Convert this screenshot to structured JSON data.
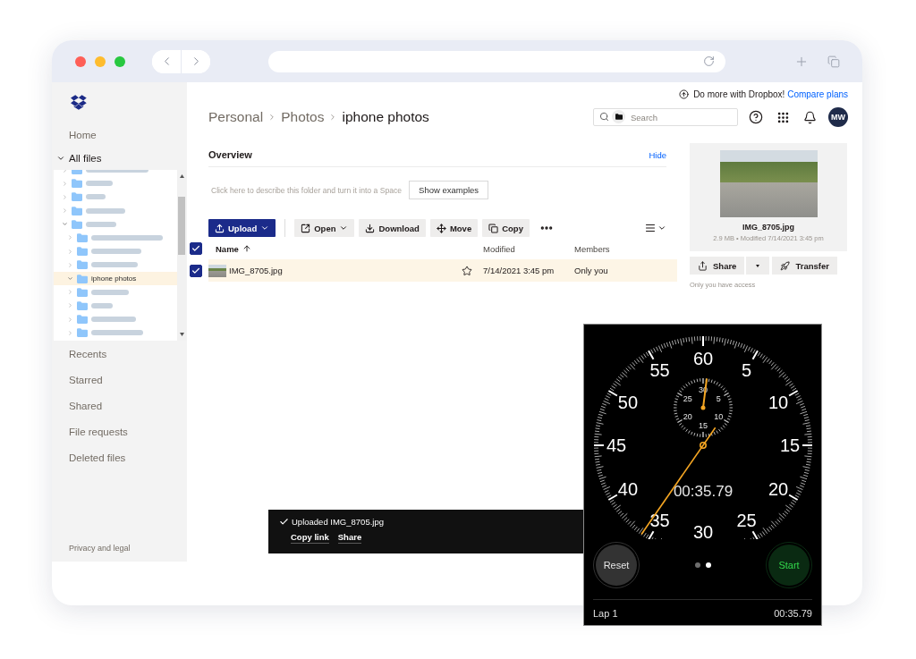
{
  "banner": {
    "text": "Do more with Dropbox!",
    "link": "Compare plans"
  },
  "breadcrumb": [
    "Personal",
    "Photos",
    "iphone photos"
  ],
  "search": {
    "placeholder": "Search"
  },
  "account": {
    "initials": "MW"
  },
  "sidebar": {
    "nav": [
      {
        "kind": "link",
        "label": "Home",
        "selected": false
      },
      {
        "kind": "section",
        "label": "All files",
        "selected": true,
        "expanded": true,
        "children": [
          {
            "kind": "blurred",
            "selected": false,
            "expanded": false
          },
          {
            "kind": "blurred",
            "selected": false,
            "expanded": false
          },
          {
            "kind": "blurred",
            "selected": false,
            "expanded": false
          },
          {
            "kind": "blurred",
            "selected": false,
            "expanded": false
          },
          {
            "kind": "blurred",
            "selected": false,
            "expanded": true,
            "children": [
              {
                "kind": "blurred",
                "selected": false,
                "expanded": false
              },
              {
                "kind": "blurred",
                "selected": false,
                "expanded": false
              },
              {
                "kind": "blurred",
                "selected": false,
                "expanded": false
              },
              {
                "kind": "named",
                "label": "iphone photos",
                "selected": true,
                "expanded": true
              },
              {
                "kind": "blurred",
                "selected": false,
                "expanded": false
              },
              {
                "kind": "blurred",
                "selected": false,
                "expanded": false
              },
              {
                "kind": "blurred",
                "selected": false,
                "expanded": false
              },
              {
                "kind": "blurred",
                "selected": false,
                "expanded": false
              }
            ]
          }
        ]
      },
      {
        "kind": "link",
        "label": "Recents",
        "selected": false
      },
      {
        "kind": "link",
        "label": "Starred",
        "selected": false
      },
      {
        "kind": "link",
        "label": "Shared",
        "selected": false
      },
      {
        "kind": "link",
        "label": "File requests",
        "selected": false
      },
      {
        "kind": "link",
        "label": "Deleted files",
        "selected": false
      }
    ],
    "footer": "Privacy and legal"
  },
  "overview": {
    "title": "Overview",
    "action": "Hide",
    "prompt": "Click here to describe this folder and turn it into a Space",
    "button": "Show examples"
  },
  "toolbar": {
    "buttons": [
      {
        "label": "Upload",
        "kind": "primary",
        "menu": true
      },
      {
        "label": "Open",
        "kind": "secondary",
        "menu": true
      },
      {
        "label": "Download",
        "kind": "secondary",
        "menu": false
      },
      {
        "label": "Move",
        "kind": "secondary",
        "menu": false
      },
      {
        "label": "Copy",
        "kind": "secondary",
        "menu": false
      }
    ]
  },
  "table": {
    "all_selected": true,
    "columns": [
      {
        "label": "Name",
        "sorted": true
      },
      {
        "label": "Modified",
        "sorted": false
      },
      {
        "label": "Members",
        "sorted": false
      }
    ],
    "rows": [
      {
        "name": "IMG_8705.jpg",
        "starred": false,
        "modified": "7/14/2021 3:45 pm",
        "members": "Only you",
        "selected": true
      }
    ]
  },
  "preview": {
    "file_name": "IMG_8705.jpg",
    "details": "2.9 MB • Modified 7/14/2021 3:45 pm",
    "share": "Share",
    "transfer": "Transfer",
    "access": "Only you have access"
  },
  "toast": {
    "message": "Uploaded IMG_8705.jpg",
    "actions": [
      "Copy link",
      "Share"
    ]
  },
  "stopwatch": {
    "dial_numbers": [
      "60",
      "5",
      "10",
      "15",
      "20",
      "25",
      "30",
      "35",
      "40",
      "45",
      "50",
      "55"
    ],
    "subdial_numbers": [
      "30",
      "5",
      "10",
      "15",
      "20",
      "25"
    ],
    "readout": "00:35.79",
    "buttons": [
      {
        "label": "Reset",
        "kind": "reset"
      },
      {
        "label": "Start",
        "kind": "start"
      }
    ],
    "pages": [
      {
        "selected": false
      },
      {
        "selected": true
      }
    ],
    "laps": [
      {
        "label": "Lap 1",
        "time": "00:35.79"
      }
    ]
  }
}
